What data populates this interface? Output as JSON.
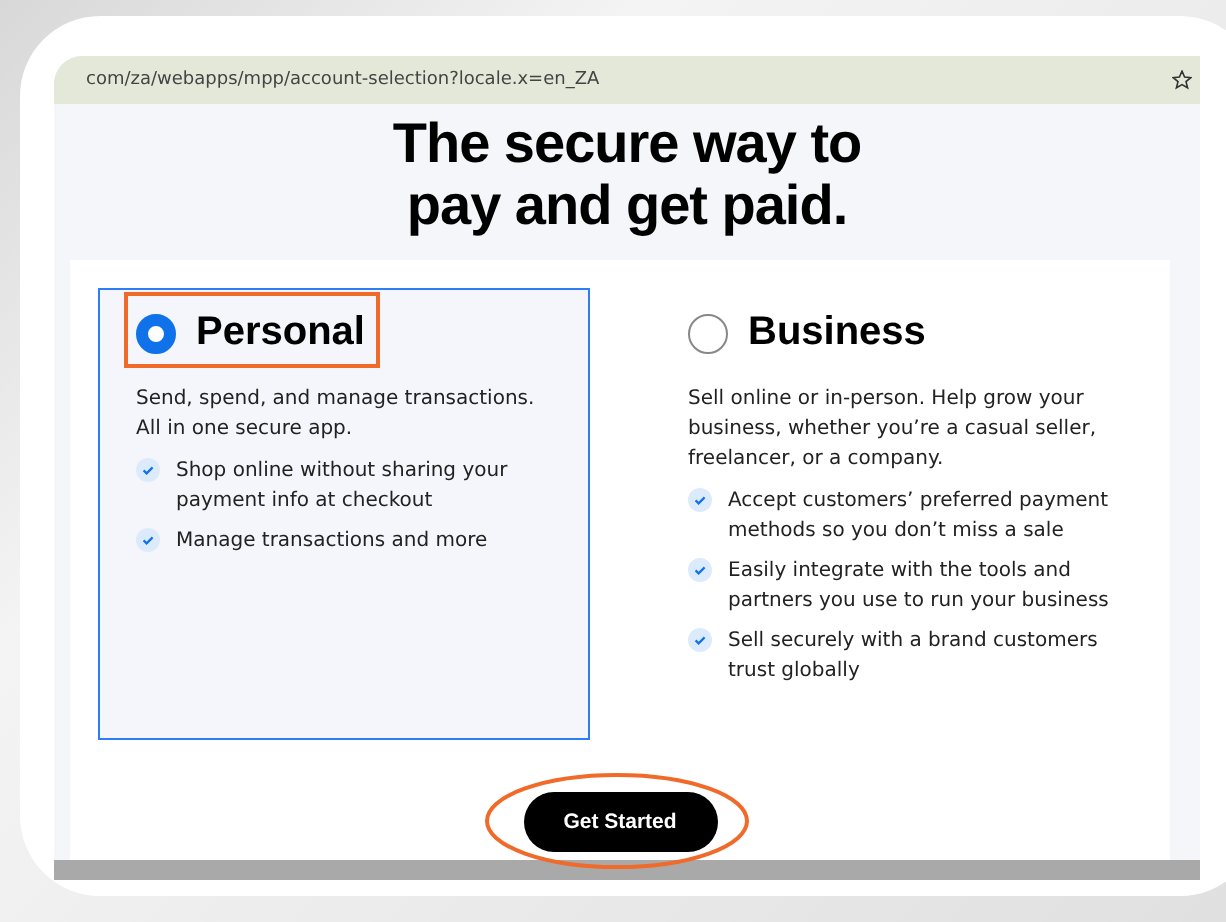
{
  "address_bar": {
    "url": "com/za/webapps/mpp/account-selection?locale.x=en_ZA"
  },
  "heading": [
    "The secure way to",
    "pay and get paid."
  ],
  "options": [
    {
      "title": "Personal",
      "selected": true,
      "description": "Send, spend, and manage transactions. All in one secure app.",
      "features": [
        "Shop online without sharing your payment info at checkout",
        "Manage transactions and more"
      ]
    },
    {
      "title": "Business",
      "selected": false,
      "description": "Sell online or in-person. Help grow your business, whether you’re a casual seller, freelancer, or a company.",
      "features": [
        "Accept customers’ preferred payment methods so you don’t miss a sale",
        "Easily integrate with the tools and partners you use to run your business",
        "Sell securely with a brand customers trust globally"
      ]
    }
  ],
  "button": "Get Started"
}
